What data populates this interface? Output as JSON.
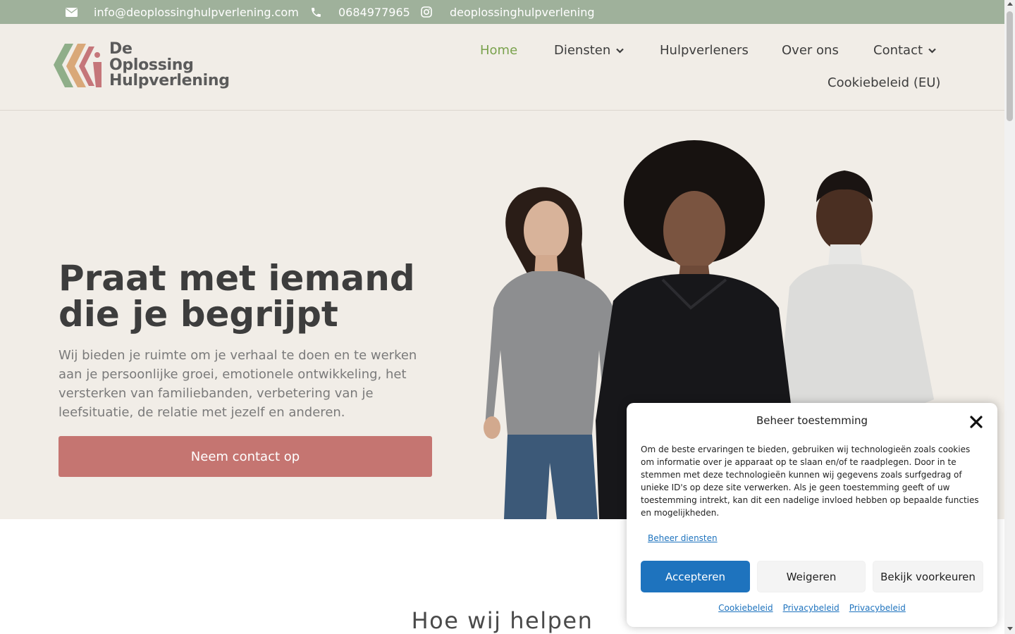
{
  "topbar": {
    "email": "info@deoplossinghulpverlening.com",
    "phone": "0684977965",
    "instagram": "deoplossinghulpverlening",
    "icons": [
      "envelope-icon",
      "phone-icon",
      "instagram-icon"
    ],
    "background": "#9fb19b"
  },
  "header": {
    "logo_line1": "De",
    "logo_line2": "Oplossing",
    "logo_line3": "Hulpverlening",
    "nav": [
      {
        "label": "Home",
        "active": true
      },
      {
        "label": "Diensten",
        "dropdown": true
      },
      {
        "label": "Hulpverleners"
      },
      {
        "label": "Over ons"
      },
      {
        "label": "Contact",
        "dropdown": true
      },
      {
        "label": "Cookiebeleid (EU)"
      }
    ],
    "active_color": "#7aa24d"
  },
  "hero": {
    "title": "Praat met iemand die je begrijpt",
    "text": "Wij bieden je ruimte om je verhaal te doen en te werken aan je persoonlijke groei, emotionele ontwikkeling, het versterken van familiebanden, verbetering van je leefsituatie, de relatie met jezelf en anderen.",
    "cta": "Neem contact op",
    "cta_color": "#c57571",
    "background": "#f1ede7"
  },
  "section": {
    "title": "Hoe wij helpen"
  },
  "consent": {
    "title": "Beheer toestemming",
    "body": "Om de beste ervaringen te bieden, gebruiken wij technologieën zoals cookies om informatie over je apparaat op te slaan en/of te raadplegen. Door in te stemmen met deze technologieën kunnen wij gegevens zoals surfgedrag of unieke ID's op deze site verwerken. Als je geen toestemming geeft of uw toestemming intrekt, kan dit een nadelige invloed hebben op bepaalde functies en mogelijkheden.",
    "manage": "Beheer diensten",
    "accept": "Accepteren",
    "deny": "Weigeren",
    "preferences": "Bekijk voorkeuren",
    "links": [
      "Cookiebeleid",
      "Privacybeleid",
      "Privacybeleid"
    ],
    "accent": "#1e73be"
  }
}
